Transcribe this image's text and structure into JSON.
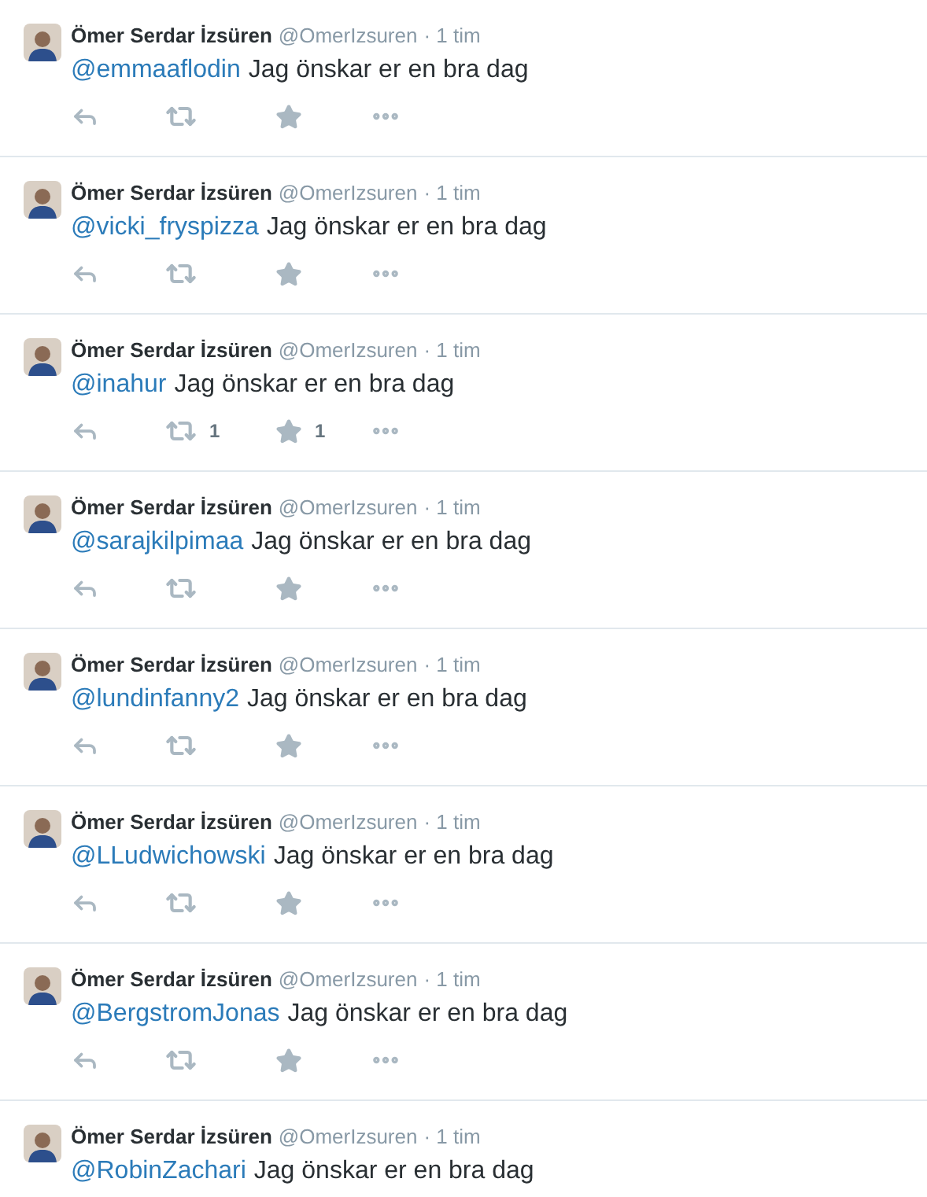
{
  "tweets": [
    {
      "name": "Ömer Serdar İzsüren",
      "handle": "@OmerIzsuren",
      "time": "· 1 tim",
      "mention": "@emmaaflodin",
      "text": "Jag önskar er en bra dag"
    },
    {
      "name": "Ömer Serdar İzsüren",
      "handle": "@OmerIzsuren",
      "time": "· 1 tim",
      "mention": "@vicki_fryspizza",
      "text": "Jag önskar er en bra dag"
    },
    {
      "name": "Ömer Serdar İzsüren",
      "handle": "@OmerIzsuren",
      "time": "· 1 tim",
      "mention": "@inahur",
      "text": "Jag önskar er en bra dag",
      "retweets": "1",
      "likes": "1"
    },
    {
      "name": "Ömer Serdar İzsüren",
      "handle": "@OmerIzsuren",
      "time": "· 1 tim",
      "mention": "@sarajkilpimaa",
      "text": "Jag önskar er en bra dag"
    },
    {
      "name": "Ömer Serdar İzsüren",
      "handle": "@OmerIzsuren",
      "time": "· 1 tim",
      "mention": "@lundinfanny2",
      "text": "Jag önskar er en bra dag"
    },
    {
      "name": "Ömer Serdar İzsüren",
      "handle": "@OmerIzsuren",
      "time": "· 1 tim",
      "mention": "@LLudwichowski",
      "text": "Jag önskar er en bra dag"
    },
    {
      "name": "Ömer Serdar İzsüren",
      "handle": "@OmerIzsuren",
      "time": "· 1 tim",
      "mention": "@BergstromJonas",
      "text": "Jag önskar er en bra dag"
    },
    {
      "name": "Ömer Serdar İzsüren",
      "handle": "@OmerIzsuren",
      "time": "· 1 tim",
      "mention": "@RobinZachari",
      "text": "Jag önskar er en bra dag"
    }
  ]
}
